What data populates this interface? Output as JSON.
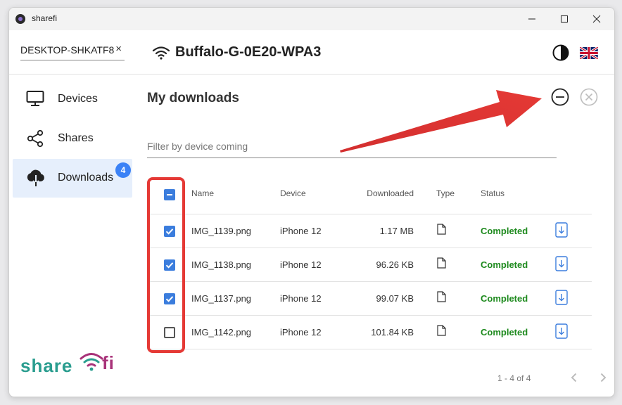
{
  "window": {
    "title": "sharefi"
  },
  "topbar": {
    "device_name": "DESKTOP-SHKATF8",
    "clear_symbol": "×",
    "network_name": "Buffalo-G-0E20-WPA3"
  },
  "sidebar": {
    "items": [
      {
        "label": "Devices",
        "icon": "monitor-icon"
      },
      {
        "label": "Shares",
        "icon": "share-icon"
      },
      {
        "label": "Downloads",
        "icon": "cloud-download-icon",
        "badge": "4"
      }
    ],
    "logo": {
      "part1": "share",
      "part2": "fi"
    }
  },
  "main": {
    "title": "My downloads",
    "filter_placeholder": "Filter by device coming",
    "columns": [
      "Name",
      "Device",
      "Downloaded",
      "Type",
      "Status"
    ],
    "rows": [
      {
        "name": "IMG_1139.png",
        "device": "iPhone 12",
        "downloaded": "1.17 MB",
        "status": "Completed",
        "checked": true
      },
      {
        "name": "IMG_1138.png",
        "device": "iPhone 12",
        "downloaded": "96.26 KB",
        "status": "Completed",
        "checked": true
      },
      {
        "name": "IMG_1137.png",
        "device": "iPhone 12",
        "downloaded": "99.07 KB",
        "status": "Completed",
        "checked": true
      },
      {
        "name": "IMG_1142.png",
        "device": "iPhone 12",
        "downloaded": "101.84 KB",
        "status": "Completed",
        "checked": false
      }
    ],
    "pagination": "1 - 4 of 4"
  },
  "colors": {
    "accent": "#3b7ddd",
    "status_completed": "#1e8a1e",
    "annotation_red": "#e53935",
    "active_nav_bg": "#e6effc"
  }
}
